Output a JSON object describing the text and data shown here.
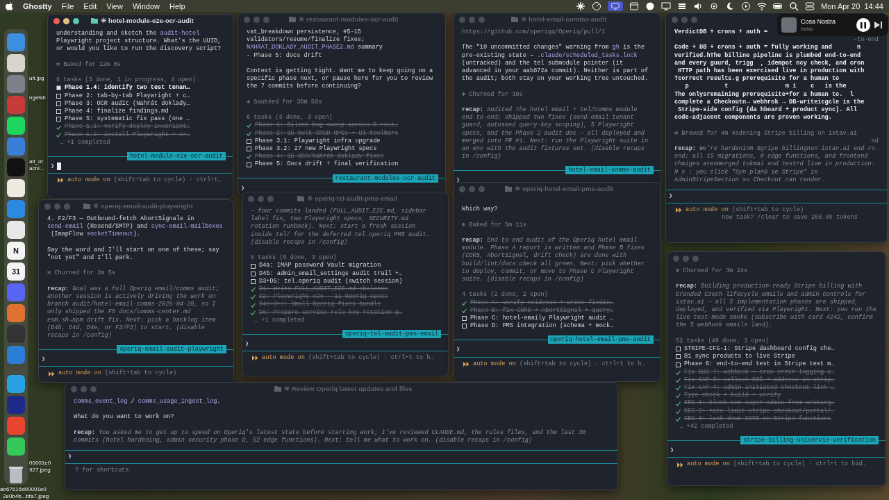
{
  "menu_bar": {
    "app": "Ghostty",
    "menus": [
      "File",
      "Edit",
      "View",
      "Window",
      "Help"
    ],
    "clock": "Mon Apr 20  14:44"
  },
  "dock": {
    "app_glyphs": [
      "N",
      "31"
    ]
  },
  "desktop_files": [
    "ult.jpg",
    "ngelsb",
    "ait_of",
    "achi...",
    "00001e0",
    "927.jpeg",
    "ab67616d00001e0",
    "2e0b4b...bfa7.jpeg"
  ],
  "now_playing": {
    "title": "Cosa Nostra",
    "artist": "belac"
  },
  "windows": [
    {
      "title": "✳ hotel-module-e2e-ocr-audit",
      "focused": true,
      "cursor": true,
      "prompt": "❯",
      "tag": "hotel-module-e2e-ocr-audit",
      "footer": {
        "kind": "mode",
        "mode": "auto mode on",
        "hint": "(shift+tab to cycle) · ctrl+t…"
      },
      "lines": [
        {
          "kind": "text",
          "parts": [
            {
              "text": "understanding and sketch the "
            },
            {
              "text": "audit-hotel",
              "code": true
            }
          ]
        },
        {
          "kind": "text",
          "text": "Playwright project structure. What's the UUID,"
        },
        {
          "kind": "text",
          "text": "or would you like to run the discovery script?"
        },
        {
          "kind": "blank"
        },
        {
          "kind": "status",
          "text": "✻ Baked for 12m 0s"
        },
        {
          "kind": "blank"
        },
        {
          "kind": "dim",
          "text": "8 tasks (3 done, 1 in progress, 4 open)"
        },
        {
          "kind": "task",
          "done": false,
          "in_progress": true,
          "text": "Phase 1.4: identify two test tenan…"
        },
        {
          "kind": "task",
          "done": false,
          "in_progress": false,
          "text": "Phase 2: tab-by-tab Playwright + c…"
        },
        {
          "kind": "task",
          "done": false,
          "in_progress": false,
          "text": "Phase 3: OCR audit (Nahrát doklady…"
        },
        {
          "kind": "task",
          "done": false,
          "in_progress": false,
          "text": "Phase 4: finalize findings.md"
        },
        {
          "kind": "task",
          "done": false,
          "in_progress": false,
          "text": "Phase 5: systematic fix pass (one …"
        },
        {
          "kind": "task",
          "done": true,
          "in_progress": false,
          "text": "Phase 1.1: verify deploy invariant…"
        },
        {
          "kind": "task",
          "done": true,
          "in_progress": false,
          "text": "Phase 1.2: install Playwright + cr…"
        },
        {
          "kind": "dim",
          "text": " … +1 completed"
        }
      ]
    },
    {
      "title": "✳ restaurant-modules-ocr-audit",
      "focused": false,
      "prompt": "❯",
      "tag": "restaurant-modules-ocr-audit",
      "lines": [
        {
          "kind": "text",
          "text": "vat_breakdown persistence, #5-15"
        },
        {
          "kind": "text",
          "text": "validators/resume/finalize fixes;"
        },
        {
          "kind": "text",
          "parts": [
            {
              "text": "NAHRAT_DOKLADY_AUDIT_PHASE2.md",
              "code": true
            },
            {
              "text": " summary"
            }
          ]
        },
        {
          "kind": "text",
          "text": "- Phase 5: docs drift"
        },
        {
          "kind": "blank"
        },
        {
          "kind": "text",
          "text": "Context is getting tight. Want me to keep going on a"
        },
        {
          "kind": "text",
          "text": "specific phase next, or pause here for you to review"
        },
        {
          "kind": "text",
          "text": "the 7 commits before continuing?"
        },
        {
          "kind": "blank"
        },
        {
          "kind": "status",
          "text": "✻ Sautéed for 30m 50s"
        },
        {
          "kind": "blank"
        },
        {
          "kind": "dim",
          "text": "6 tasks (3 done, 3 open)"
        },
        {
          "kind": "task",
          "done": true,
          "text": "Phase 1: Silent-bug sweep across 5 rest…"
        },
        {
          "kind": "task",
          "done": true,
          "text": "Phase 2: 15 bulk-CRUD RPCs + UI toolbars"
        },
        {
          "kind": "task",
          "done": false,
          "text": "Phase 3.1: Playwright infra upgrade"
        },
        {
          "kind": "task",
          "done": false,
          "text": "Phase 3.2: 27 new Playwright specs"
        },
        {
          "kind": "task",
          "done": true,
          "text": "Phase 4: 15 OCR/Nahrát doklady fixes"
        },
        {
          "kind": "task",
          "done": false,
          "text": "Phase 5: Docs drift + final verification"
        }
      ]
    },
    {
      "title": "✳ hotel-email-comms-audit",
      "focused": false,
      "prompt": "❯",
      "tag": "hotel-email-comms-audit",
      "lines": [
        {
          "kind": "dim",
          "text": "https://github.com/operiqq/Operiq/pull/1"
        },
        {
          "kind": "blank"
        },
        {
          "kind": "text",
          "parts": [
            {
              "text": "The \"10 uncommitted changes\" warning from "
            },
            {
              "text": "gh",
              "code": true
            },
            {
              "text": " is the"
            }
          ]
        },
        {
          "kind": "text",
          "parts": [
            {
              "text": "pre-existing state — "
            },
            {
              "text": ".claude/scheduled_tasks.lock",
              "code": true
            }
          ]
        },
        {
          "kind": "text",
          "text": "(untracked) and the tel submodule pointer (it"
        },
        {
          "kind": "text",
          "text": "advanced in your aab872a commit). Neither is part of"
        },
        {
          "kind": "text",
          "text": "the audit; both stay on your working tree untouched."
        },
        {
          "kind": "blank"
        },
        {
          "kind": "status",
          "text": "✻ Churned for 39s"
        },
        {
          "kind": "blank"
        },
        {
          "kind": "recap",
          "label": "recap:",
          "text": "Audited the hotel email + tel/comms module end-to-end; shipped two fixes (send-email tenant guard, autosend query-key scoping), 5 Playwright specs, and the Phase 2 audit doc — all deployed and merged into PR #1. Next: run the Playwright suite in an env with the audit fixtures set. (disable recaps in /config)"
        }
      ]
    },
    {
      "focused": false,
      "prompt": "❯",
      "footer": {
        "kind": "mode",
        "mode": "auto mode on",
        "hint": "(shift+tab to cycle)",
        "extra": "new task? /clear to save 268.8k tokens"
      },
      "lines": [
        {
          "kind": "strong",
          "text": "VerdictDB + crons + auth ="
        },
        {
          "kind": "fragment",
          "text": "-to-end"
        },
        {
          "kind": "strong",
          "text": "Code + DB + crons + auth = fully working and       n"
        },
        {
          "kind": "strong",
          "text": "verified.hThe billine pipeline is plumbed end-to-end"
        },
        {
          "kind": "strong",
          "text": "and every guurd, trigg  , idempot ncy check, and cron"
        },
        {
          "kind": "strong",
          "text": " HTTP path has been exercised live in production with"
        },
        {
          "kind": "strong",
          "text": "Tcorrect results.g prerequisite for a human to"
        },
        {
          "kind": "strong",
          "text": "   p          t                m i    c   is the"
        },
        {
          "kind": "strong",
          "text": "The onlysremaining prersquisite+for a human to.  l"
        },
        {
          "kind": "strong",
          "text": "complete a Checkoutn→ webhrok → DB-writeicgcle is the"
        },
        {
          "kind": "strong",
          "text": " Stripe-side config (da hboard + product sync). All"
        },
        {
          "kind": "strong",
          "text": "code-adjacent components are proven working."
        },
        {
          "kind": "blank"
        },
        {
          "kind": "status",
          "text": "✻ Brewed for 4m 4sdening Stripe billing on istav.ai"
        },
        {
          "kind": "fragment",
          "text": "nd"
        },
        {
          "kind": "recap",
          "label": "recap:",
          "text": "We're hardeninm Sgripe billingnon istav.ai end-ro-end; all 15 migrations, 8 edge functions, and frontend chaiges areomerged tokmai  and testrd live in production. N x : you click \"Syn  plan0 se Stripe\" in AdminStripeSection so Checkout can render."
        }
      ]
    },
    {
      "title": "✳ operiq-email-audit-playwright",
      "focused": false,
      "prompt": "❯",
      "tag": "operiq-email-audit-playwright",
      "footer": {
        "kind": "mode",
        "mode": "auto mode on",
        "hint": "(shift+tab to cycle)"
      },
      "lines": [
        {
          "kind": "text",
          "text": "4. F2/F3 — Outbound-fetch AbortSignals in"
        },
        {
          "kind": "text",
          "parts": [
            {
              "text": "send-email",
              "code": true
            },
            {
              "text": " (Resend/SMTP) and "
            },
            {
              "text": "sync-email-mailboxes",
              "code": true
            }
          ]
        },
        {
          "kind": "text",
          "parts": [
            {
              "text": " (ImapFlow "
            },
            {
              "text": "socketTimeout",
              "code": true
            },
            {
              "text": ")."
            }
          ]
        },
        {
          "kind": "blank"
        },
        {
          "kind": "text",
          "text": "Say the word and I'll start on one of these; say"
        },
        {
          "kind": "text",
          "text": "\"not yet\" and I'll park."
        },
        {
          "kind": "blank"
        },
        {
          "kind": "status",
          "text": "✻ Churned for 2m 5s"
        },
        {
          "kind": "blank"
        },
        {
          "kind": "recap",
          "label": "recap:",
          "text": "Goal was a full Operiq email/comms audit; another session is actively driving the work on branch audit/hotel-email-comms-2026-04-20, so I only shipped the F8 docs/comms-center.md esm.sh→npm drift fix. Next: pick a backlog item (D4b, D4d, D4e, or F2/F3) to start. (disable recaps in /config)"
        }
      ]
    },
    {
      "title": "✳ operiq-tel-audit-pms-email",
      "focused": false,
      "prompt": "❯",
      "tag": "operiq-tel-audit-pms-email",
      "footer": {
        "kind": "mode",
        "mode": "auto mode on",
        "hint": "(shift+tab to cycle) · ctrl+t to h…"
      },
      "lines": [
        {
          "kind": "recap",
          "text": "— four commits landed (FULL_AUDIT_E2E.md, sidebar label fix, two Playwright specs, SECURITY.md rotation runbook). Next: start a fresh session inside tel/ for the deferred tel.operiq PMS audit. (disable recaps in /config)"
        },
        {
          "kind": "blank"
        },
        {
          "kind": "dim",
          "text": "8 tasks (5 done, 3 open)"
        },
        {
          "kind": "task",
          "done": false,
          "text": "D4a: IMAP password Vault migration"
        },
        {
          "kind": "task",
          "done": false,
          "text": "D4b: admin_email_settings audit trail +…"
        },
        {
          "kind": "task",
          "done": false,
          "text": "D3+D5: tel.operiq audit (switch session)"
        },
        {
          "kind": "task",
          "done": true,
          "text": "D1: Write FULL_AUDIT_E2E.md skeleton"
        },
        {
          "kind": "task",
          "done": true,
          "text": "D2: Playwright e2e — 11 Operiq specs"
        },
        {
          "kind": "task",
          "done": true,
          "text": "D4c+d+e: Small Operiq fixes bundle"
        },
        {
          "kind": "task",
          "done": true,
          "text": "D6: Prepare service-role key rotation p…"
        },
        {
          "kind": "dim",
          "text": " … +1 completed"
        }
      ]
    },
    {
      "title": "✳ operiq-hotel-email-pms-audit",
      "focused": false,
      "prompt": "❯",
      "tag": "operiq-hotel-email-pms-audit",
      "footer": {
        "kind": "mode",
        "mode": "auto mode on",
        "hint": "(shift+tab to cycle) · ctrl+t to h…"
      },
      "lines": [
        {
          "kind": "blank"
        },
        {
          "kind": "text",
          "text": "Which way?"
        },
        {
          "kind": "blank"
        },
        {
          "kind": "status",
          "text": "✻ Baked for 5m 11s"
        },
        {
          "kind": "blank"
        },
        {
          "kind": "recap",
          "label": "recap:",
          "text": "End-to-end audit of the Operiq hotel email module. Phase A report is written and Phase B fixes (CORS, AbortSignal, drift check) are done with build/lint/docs:check all green. Next: pick whether to deploy, commit, or move to Phase C Playwright suite. (disable recaps in /config)"
        },
        {
          "kind": "blank"
        },
        {
          "kind": "dim",
          "text": "4 tasks (2 done, 2 open)"
        },
        {
          "kind": "task",
          "done": true,
          "text": "Phase A: verify evidence + write findin…"
        },
        {
          "kind": "task",
          "done": true,
          "text": "Phase B: fix CORS + AbortSignal + query…"
        },
        {
          "kind": "task",
          "done": false,
          "text": "Phase C: hotel-emaily Playwright audit …"
        },
        {
          "kind": "task",
          "done": false,
          "text": "Phase D: PMS integration (schema + mock…"
        }
      ]
    },
    {
      "focused": false,
      "prompt": "❯",
      "tag": "stripe-billing-uniservis-verification",
      "footer": {
        "kind": "mode",
        "mode": "auto mode on",
        "hint": "(shift+tab to cycle) · ctrl+t to hid…"
      },
      "lines": [
        {
          "kind": "status",
          "text": "✻ Churned for 3m 24s"
        },
        {
          "kind": "blank"
        },
        {
          "kind": "recap",
          "label": "recap:",
          "text": "Building production-ready Stripe billing with branded Czech lifecycle emails and admin controls for istav.ai — all 5 implementation phases are shipped, deployed, and verified via Playwright. Next: you run the live test-mode smoke (subscribe with card 4242, confirm the 5 webhook emails land)."
        },
        {
          "kind": "blank"
        },
        {
          "kind": "dim",
          "text": "52 tasks (49 done, 3 open)"
        },
        {
          "kind": "task",
          "done": false,
          "text": "STRIPE-CFG-1: Stripe dashboard config che…"
        },
        {
          "kind": "task",
          "done": false,
          "text": "B1 sync products to live Stripe"
        },
        {
          "kind": "task",
          "done": false,
          "text": "Phase 6: end-to-end test in Stripe test m…"
        },
        {
          "kind": "task",
          "done": true,
          "text": "Fix BUG-7: webhook + cron error logging c…"
        },
        {
          "kind": "task",
          "done": true,
          "text": "Fix GAP-3: collect DIČ + address in strip…"
        },
        {
          "kind": "task",
          "done": true,
          "text": "Fix GAP-4: admin-initiated checkout link …"
        },
        {
          "kind": "task",
          "done": true,
          "text": "Type-check + build + verify"
        },
        {
          "kind": "task",
          "done": true,
          "text": "SEC-1: block non-super-admin from writing…"
        },
        {
          "kind": "task",
          "done": true,
          "text": "SEC-2: rate limit stripe-checkout/portal/…"
        },
        {
          "kind": "task",
          "done": true,
          "text": "SEC-3: lock down CORS on Stripe functions"
        },
        {
          "kind": "dim",
          "text": " … +42 completed"
        }
      ]
    },
    {
      "title": "✳ Review Operiq latest updates and files",
      "focused": false,
      "prompt": "❯",
      "footer": {
        "kind": "hint",
        "text": "? for shortcuts"
      },
      "lines": [
        {
          "kind": "text",
          "parts": [
            {
              "text": "comms_event_log",
              "code": true
            },
            {
              "text": " / "
            },
            {
              "text": "comms_usage_ingest_log",
              "code": true
            },
            {
              "text": "."
            }
          ]
        },
        {
          "kind": "blank"
        },
        {
          "kind": "text",
          "text": "What do you want to work on?"
        },
        {
          "kind": "blank"
        },
        {
          "kind": "recap",
          "label": "recap:",
          "text": "You asked me to get up to speed on Operiq's latest state before starting work; I've reviewed CLAUDE.md, the rules files, and the last 30 commits (hotel hardening, admin security phase D, 52 edge functions). Next: tell me what to work on. (disable recaps in /config)"
        }
      ]
    }
  ]
}
